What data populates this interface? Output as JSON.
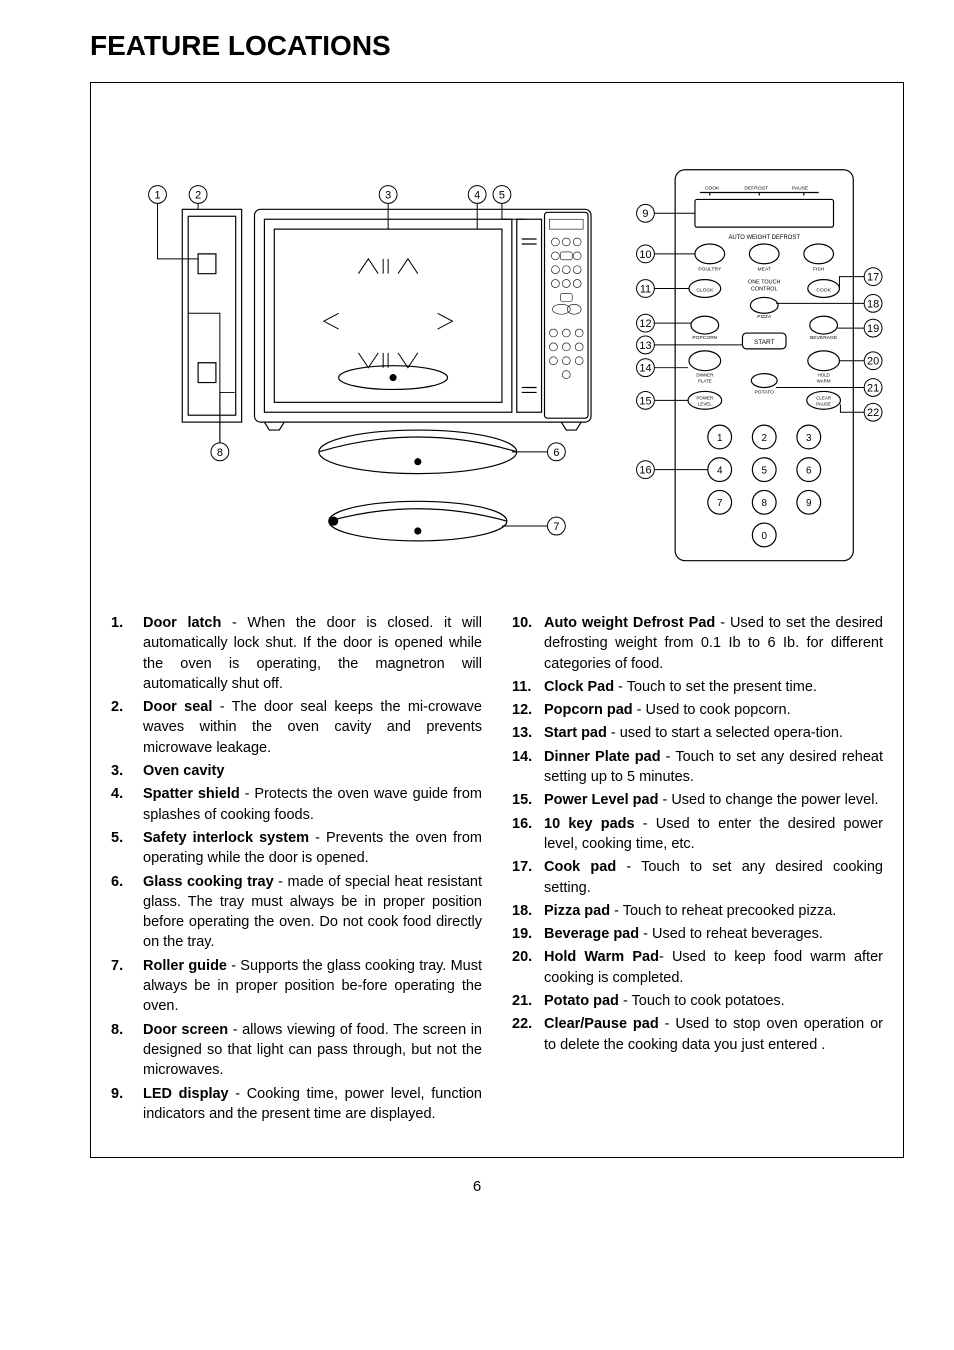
{
  "title": "FEATURE LOCATIONS",
  "page_number": "6",
  "items_left": [
    {
      "num": "1.",
      "term": "Door latch",
      "desc": " - When the door is closed. it will automatically lock shut. If the door is opened while the oven is operating, the magnetron will automatically shut off."
    },
    {
      "num": "2.",
      "term": "Door seal",
      "desc": " - The door seal keeps the mi-crowave waves within the oven cavity and prevents microwave leakage."
    },
    {
      "num": "3.",
      "term": "Oven cavity",
      "desc": ""
    },
    {
      "num": "4.",
      "term": "Spatter shield",
      "desc": " - Protects the oven wave guide from splashes of cooking foods."
    },
    {
      "num": "5.",
      "term": "Safety interlock system",
      "desc": " - Prevents the oven from operating while the door is opened."
    },
    {
      "num": "6.",
      "term": "Glass cooking tray",
      "desc": " - made of special heat resistant glass. The tray must always be in proper position before operating the oven. Do not cook food directly on the tray."
    },
    {
      "num": "7.",
      "term": "Roller guide",
      "desc": " - Supports the glass cooking tray. Must always be in proper position be-fore operating the oven."
    },
    {
      "num": "8.",
      "term": "Door screen",
      "desc": " - allows viewing of food. The screen in designed so that light can pass through, but not the microwaves."
    },
    {
      "num": "9.",
      "term": "LED display",
      "desc": " - Cooking time, power level, function indicators and the present time are displayed."
    }
  ],
  "items_right": [
    {
      "num": "10.",
      "term": "Auto weight Defrost Pad",
      "desc": " - Used to set the desired defrosting weight from 0.1 Ib to 6 Ib. for different categories of food."
    },
    {
      "num": "11.",
      "term": "Clock Pad",
      "desc": " - Touch to set the present time."
    },
    {
      "num": "12.",
      "term": "Popcorn pad",
      "desc": " - Used to cook popcorn."
    },
    {
      "num": "13.",
      "term": "Start pad",
      "desc": " - used to start a selected opera-tion."
    },
    {
      "num": "14.",
      "term": "Dinner Plate pad",
      "desc": " - Touch to set any desired reheat setting up to 5 minutes."
    },
    {
      "num": "15.",
      "term": "Power Level pad",
      "desc": " - Used to change the power level."
    },
    {
      "num": "16.",
      "term": "10 key pads",
      "desc": " - Used to enter  the desired power level, cooking time, etc."
    },
    {
      "num": "17.",
      "term": "Cook pad",
      "desc": " - Touch to set any desired cooking setting."
    },
    {
      "num": "18.",
      "term": "Pizza pad",
      "desc": " - Touch to reheat precooked pizza."
    },
    {
      "num": "19.",
      "term": "Beverage pad",
      "desc": " - Used to reheat beverages."
    },
    {
      "num": "20.",
      "term": "Hold Warm Pad",
      "desc": "- Used to keep food warm after cooking is completed."
    },
    {
      "num": "21.",
      "term": "Potato pad",
      "desc": " - Touch to cook potatoes."
    },
    {
      "num": "22.",
      "term": "Clear/Pause pad",
      "desc": " - Used to stop oven operation or to delete the cooking data you just entered ."
    }
  ],
  "panel_labels": {
    "cook": "COOK",
    "defrost": "DEFROST",
    "pause": "PAUSE",
    "awd": "AUTO WEIGHT DEFROST",
    "poultry": "POULTRY",
    "meat": "MEAT",
    "fish": "FISH",
    "otc": "ONE TOUCH\nCONTROL",
    "clock_btn": "CLOCK",
    "cook_btn": "COOK",
    "pizza": "PIZZA",
    "popcorn": "POPCORN",
    "beverage": "BEVERAGE",
    "start": "START",
    "dinner": "DINNER\nPLATE",
    "hold": "HOLD\nWARM",
    "potato": "POTATO",
    "power": "POWER\nLEVEL",
    "clear": "CLEAR\nPAUSE"
  }
}
